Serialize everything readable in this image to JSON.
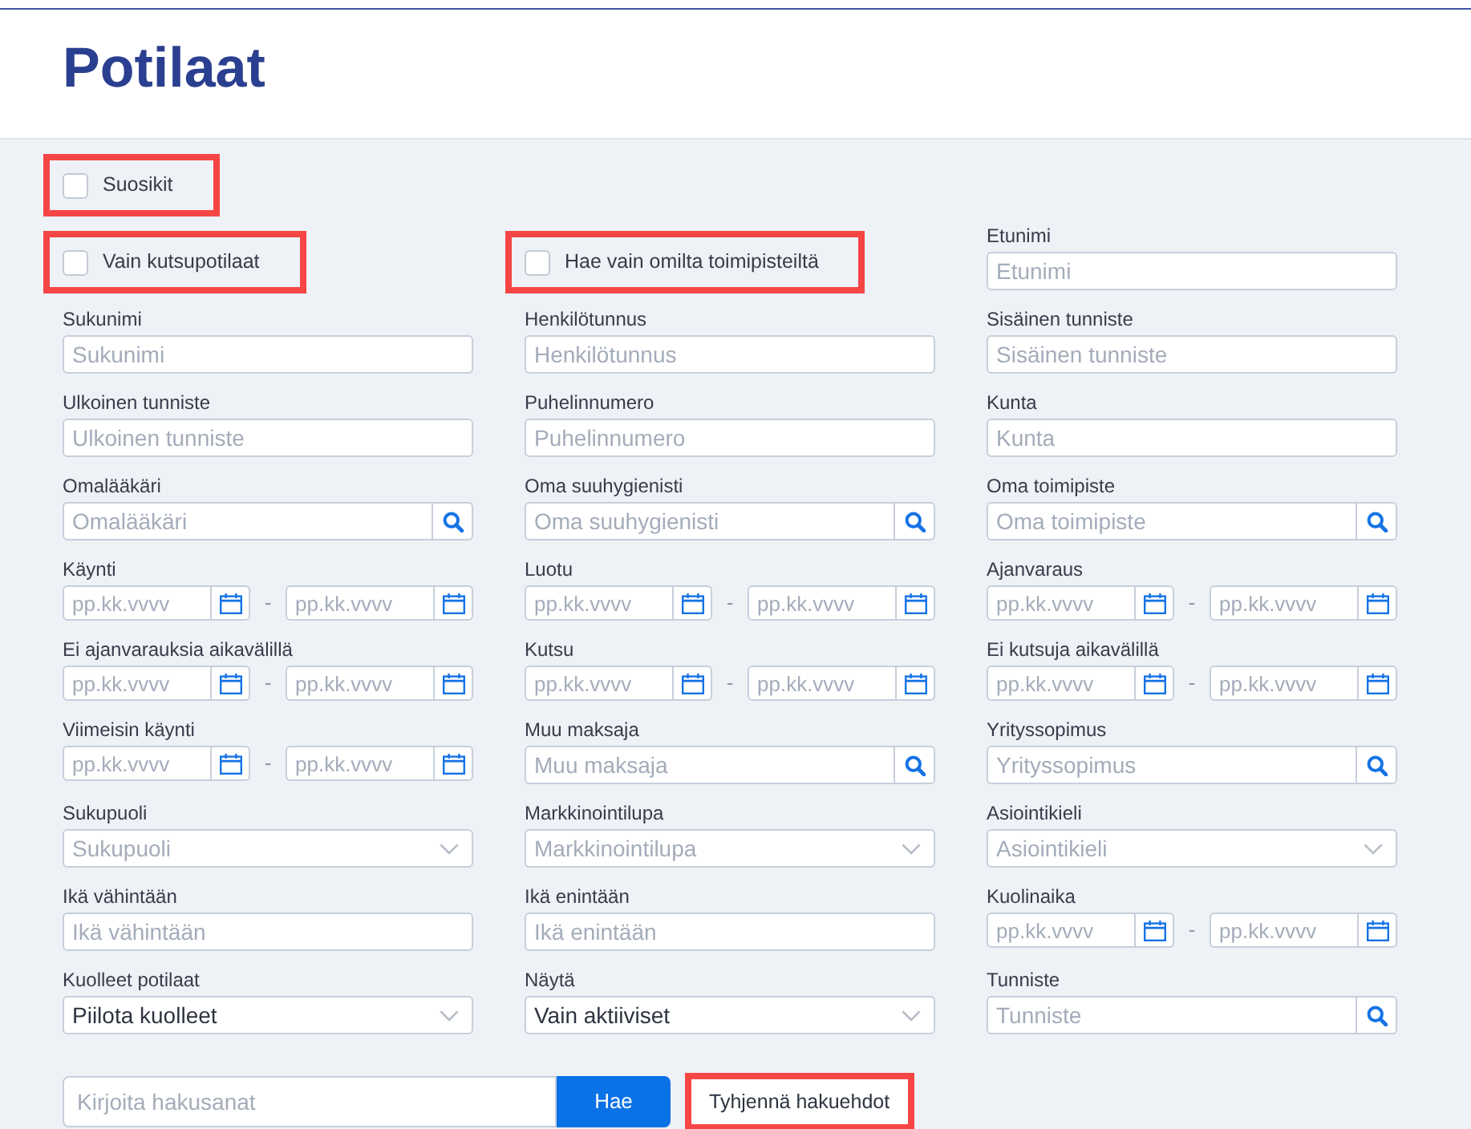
{
  "header": {
    "title": "Potilaat"
  },
  "favorites": {
    "label": "Suosikit",
    "checked": false,
    "highlighted": true
  },
  "filters": [
    {
      "kind": "checkbox",
      "label": "Vain kutsupotilaat",
      "checked": false,
      "highlighted": true
    },
    {
      "kind": "checkbox",
      "label": "Hae vain omilta toimipisteiltä",
      "checked": false,
      "highlighted": true
    },
    {
      "kind": "text",
      "label": "Etunimi",
      "placeholder": "Etunimi"
    },
    {
      "kind": "text",
      "label": "Sukunimi",
      "placeholder": "Sukunimi"
    },
    {
      "kind": "text",
      "label": "Henkilötunnus",
      "placeholder": "Henkilötunnus"
    },
    {
      "kind": "text",
      "label": "Sisäinen tunniste",
      "placeholder": "Sisäinen tunniste"
    },
    {
      "kind": "text",
      "label": "Ulkoinen tunniste",
      "placeholder": "Ulkoinen tunniste"
    },
    {
      "kind": "text",
      "label": "Puhelinnumero",
      "placeholder": "Puhelinnumero"
    },
    {
      "kind": "text",
      "label": "Kunta",
      "placeholder": "Kunta"
    },
    {
      "kind": "lookup",
      "label": "Omalääkäri",
      "placeholder": "Omalääkäri"
    },
    {
      "kind": "lookup",
      "label": "Oma suuhygienisti",
      "placeholder": "Oma suuhygienisti"
    },
    {
      "kind": "lookup",
      "label": "Oma toimipiste",
      "placeholder": "Oma toimipiste"
    },
    {
      "kind": "date_range",
      "label": "Käynti",
      "from": {
        "placeholder": "pp.kk.vvvv"
      },
      "separator": "-",
      "to": {
        "placeholder": "pp.kk.vvvv"
      }
    },
    {
      "kind": "date_range",
      "label": "Luotu",
      "from": {
        "placeholder": "pp.kk.vvvv"
      },
      "separator": "-",
      "to": {
        "placeholder": "pp.kk.vvvv"
      }
    },
    {
      "kind": "date_range",
      "label": "Ajanvaraus",
      "from": {
        "placeholder": "pp.kk.vvvv"
      },
      "separator": "-",
      "to": {
        "placeholder": "pp.kk.vvvv"
      }
    },
    {
      "kind": "date_range",
      "label": "Ei ajanvarauksia aikavälillä",
      "from": {
        "placeholder": "pp.kk.vvvv"
      },
      "separator": "-",
      "to": {
        "placeholder": "pp.kk.vvvv"
      }
    },
    {
      "kind": "date_range",
      "label": "Kutsu",
      "from": {
        "placeholder": "pp.kk.vvvv"
      },
      "separator": "-",
      "to": {
        "placeholder": "pp.kk.vvvv"
      }
    },
    {
      "kind": "date_range",
      "label": "Ei kutsuja aikavälillä",
      "from": {
        "placeholder": "pp.kk.vvvv"
      },
      "separator": "-",
      "to": {
        "placeholder": "pp.kk.vvvv"
      }
    },
    {
      "kind": "date_range",
      "label": "Viimeisin käynti",
      "from": {
        "placeholder": "pp.kk.vvvv"
      },
      "separator": "-",
      "to": {
        "placeholder": "pp.kk.vvvv"
      }
    },
    {
      "kind": "lookup",
      "label": "Muu maksaja",
      "placeholder": "Muu maksaja"
    },
    {
      "kind": "lookup",
      "label": "Yrityssopimus",
      "placeholder": "Yrityssopimus"
    },
    {
      "kind": "select",
      "label": "Sukupuoli",
      "placeholder": "Sukupuoli"
    },
    {
      "kind": "select",
      "label": "Markkinointilupa",
      "placeholder": "Markkinointilupa"
    },
    {
      "kind": "select",
      "label": "Asiointikieli",
      "placeholder": "Asiointikieli"
    },
    {
      "kind": "text",
      "label": "Ikä vähintään",
      "placeholder": "Ikä vähintään"
    },
    {
      "kind": "text",
      "label": "Ikä enintään",
      "placeholder": "Ikä enintään"
    },
    {
      "kind": "date_range",
      "label": "Kuolinaika",
      "from": {
        "placeholder": "pp.kk.vvvv"
      },
      "separator": "-",
      "to": {
        "placeholder": "pp.kk.vvvv"
      }
    },
    {
      "kind": "select",
      "label": "Kuolleet potilaat",
      "value": "Piilota kuolleet"
    },
    {
      "kind": "select",
      "label": "Näytä",
      "value": "Vain aktiiviset"
    },
    {
      "kind": "lookup",
      "label": "Tunniste",
      "placeholder": "Tunniste"
    }
  ],
  "search": {
    "placeholder": "Kirjoita hakusanat",
    "button": "Hae"
  },
  "clear_button": {
    "label": "Tyhjennä hakuehdot",
    "highlighted": true
  }
}
